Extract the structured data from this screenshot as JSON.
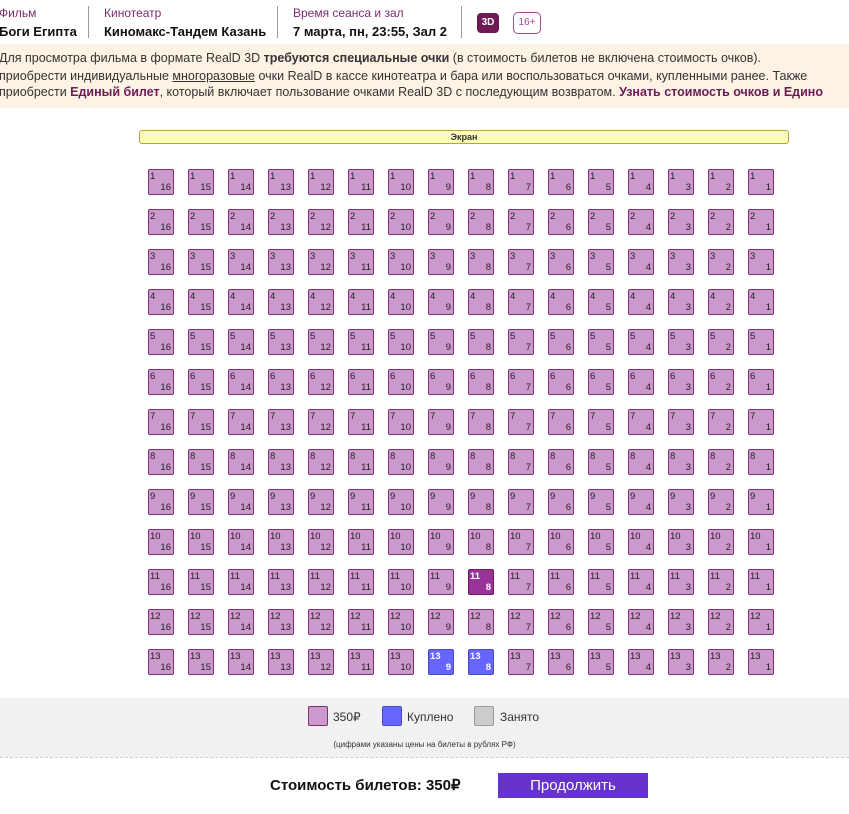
{
  "header": {
    "film_label": "Фильм",
    "film_value": "Боги Египта",
    "cinema_label": "Кинотеатр",
    "cinema_value": "Киномакс-Тандем Казань",
    "session_label": "Время сеанса и зал",
    "session_value": "7 марта, пн, 23:55, Зал 2",
    "format_badge": "3D",
    "age_badge": "16+"
  },
  "notice": {
    "l1_a": "Для просмотра фильма в формате RealD 3D ",
    "l1_b": "требуются специальные очки",
    "l1_c": " (в стоимость билетов не включена стоимость очков).",
    "l2_a": "приобрести индивидуальные ",
    "l2_b": "многоразовые",
    "l2_c": " очки RealD в кассе кинотеатра и бара или воспользоваться очками, купленными ранее. Также",
    "l3_a": "приобрести ",
    "l3_b": "Единый билет",
    "l3_c": ", который включает пользование очками RealD 3D с последующим возвратом. ",
    "l3_d": "Узнать стоимость очков и Едино"
  },
  "screen_label": "Экран",
  "seatmap": {
    "rows": 13,
    "seats_per_row": 16,
    "purchased": [
      [
        13,
        9
      ],
      [
        13,
        8
      ]
    ],
    "selected": [
      [
        11,
        8
      ]
    ]
  },
  "colors": {
    "available": "#cc99cc",
    "purchased": "#6666ff",
    "occupied": "#cccccc",
    "selected": "#993399",
    "accent": "#6633cc",
    "brand": "#6e1a55"
  },
  "legend": {
    "price": "350₽",
    "purchased": "Куплено",
    "occupied": "Занято"
  },
  "price_note": "(цифрами указаны цены на билеты в рублях РФ)",
  "footer": {
    "total": "Стоимость билетов: 350₽",
    "continue": "Продолжить"
  }
}
